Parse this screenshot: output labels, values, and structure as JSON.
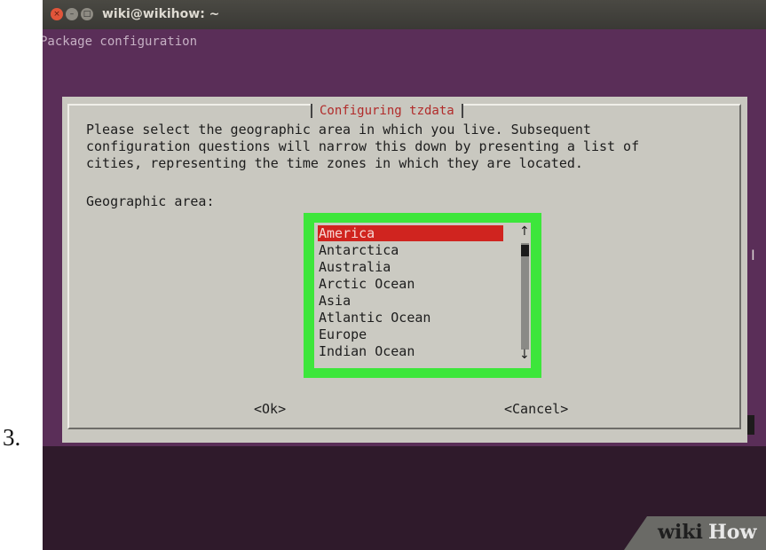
{
  "step_number": "3.",
  "window": {
    "title": "wiki@wikihow: ~",
    "close_glyph": "×",
    "minimize_glyph": "–",
    "maximize_glyph": "□"
  },
  "terminal": {
    "header": "Package configuration",
    "text_cursor": "I"
  },
  "dialog": {
    "title": "Configuring tzdata",
    "prompt": "Please select the geographic area in which you live. Subsequent\nconfiguration questions will narrow this down by presenting a list of\ncities, representing the time zones in which they are located.",
    "area_label": "Geographic area:",
    "options": [
      "America",
      "Antarctica",
      "Australia",
      "Arctic Ocean",
      "Asia",
      "Atlantic Ocean",
      "Europe",
      "Indian Ocean"
    ],
    "selected_option": "America",
    "scroll_up": "↑",
    "scroll_down": "↓",
    "ok_label": "<Ok>",
    "cancel_label": "<Cancel>"
  },
  "watermark": {
    "wiki": "wiki",
    "how": "How"
  },
  "colors": {
    "terminal_bg": "#5a2e58",
    "dialog_bg": "#c9c8c0",
    "title_red": "#b12b2a",
    "selection_red": "#d0241f",
    "highlight_green": "#3de63b"
  }
}
